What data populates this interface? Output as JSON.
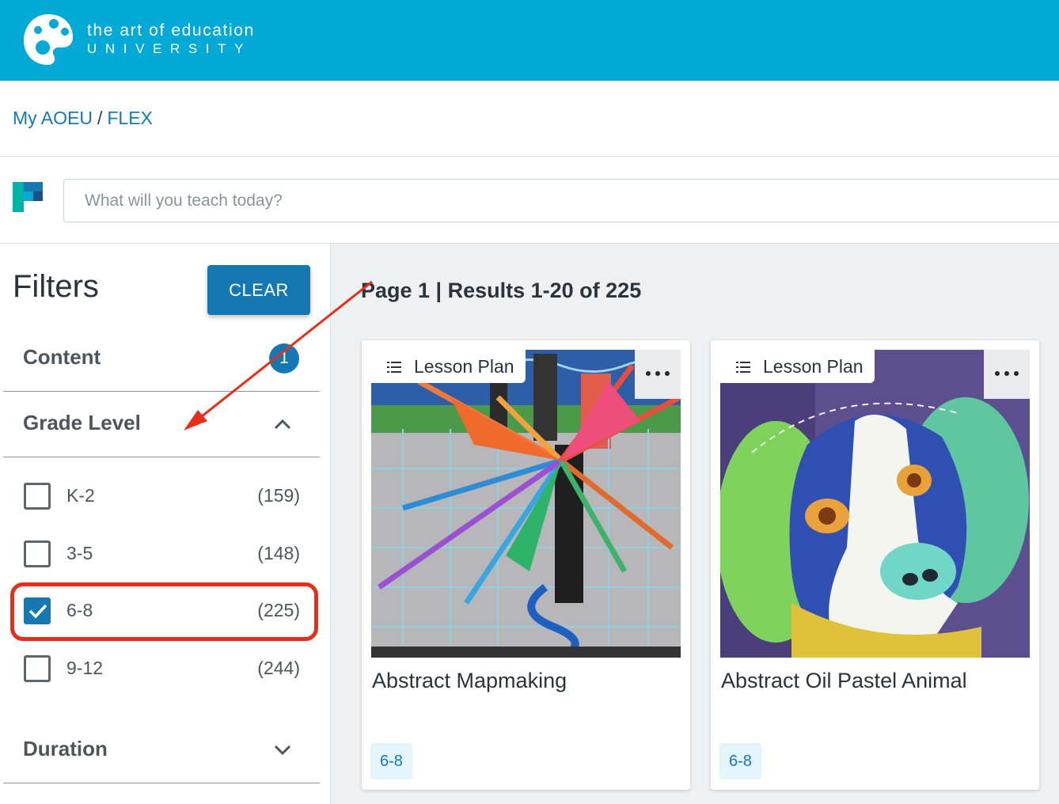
{
  "header": {
    "logo_line1": "the art of education",
    "logo_line2": "UNIVERSITY",
    "brand_color": "#00a9d6"
  },
  "breadcrumb": {
    "items": [
      "My AOEU",
      "FLEX"
    ],
    "separator": "/"
  },
  "search": {
    "placeholder": "What will you teach today?",
    "value": ""
  },
  "sidebar": {
    "title": "Filters",
    "clear_label": "CLEAR",
    "content": {
      "label": "Content",
      "badge": "1"
    },
    "grade_level": {
      "label": "Grade Level",
      "expanded": true,
      "options": [
        {
          "label": "K-2",
          "count": "(159)",
          "checked": false
        },
        {
          "label": "3-5",
          "count": "(148)",
          "checked": false
        },
        {
          "label": "6-8",
          "count": "(225)",
          "checked": true
        },
        {
          "label": "9-12",
          "count": "(244)",
          "checked": false
        }
      ]
    },
    "duration": {
      "label": "Duration",
      "expanded": false
    }
  },
  "results": {
    "heading": "Page 1 | Results 1-20 of 225",
    "cards": [
      {
        "type": "Lesson Plan",
        "title": "Abstract Mapmaking",
        "grade": "6-8"
      },
      {
        "type": "Lesson Plan",
        "title": "Abstract Oil Pastel Animal",
        "grade": "6-8"
      }
    ]
  },
  "colors": {
    "accent": "#1678b3",
    "annotation_red": "#ea2d17"
  },
  "icons": [
    "palette-logo-icon",
    "flex-logo-icon",
    "chevron-up-icon",
    "chevron-down-icon",
    "list-icon",
    "more-dots-icon",
    "checkmark-icon"
  ]
}
